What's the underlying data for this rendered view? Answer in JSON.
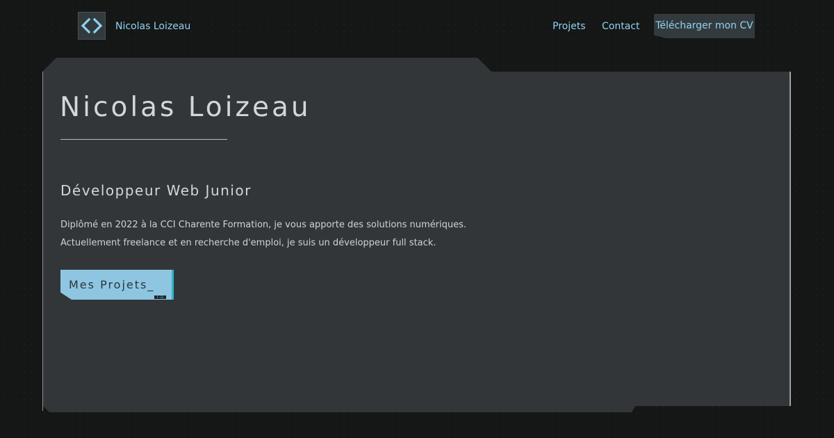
{
  "header": {
    "logo_icon": "code-brackets-icon",
    "brand_name": "Nicolas Loizeau",
    "nav": {
      "projets": "Projets",
      "contact": "Contact",
      "cv_button": "Télécharger mon CV"
    }
  },
  "hero": {
    "title": "Nicolas Loizeau",
    "subtitle": "Développeur Web Junior",
    "description_line1": "Diplômé en 2022 à la CCI Charente Formation, je vous apporte des solutions numériques.",
    "description_line2": "Actuellement freelance et en recherche d'emploi, je suis un développeur full stack.",
    "projects_button": "Mes Projets_",
    "projects_button_tag": "F-23"
  },
  "colors": {
    "background": "#151616",
    "panel": "#323639",
    "accent": "#8fd3f0",
    "button": "#8ec6e2",
    "button_edge": "#2bb7c7"
  }
}
